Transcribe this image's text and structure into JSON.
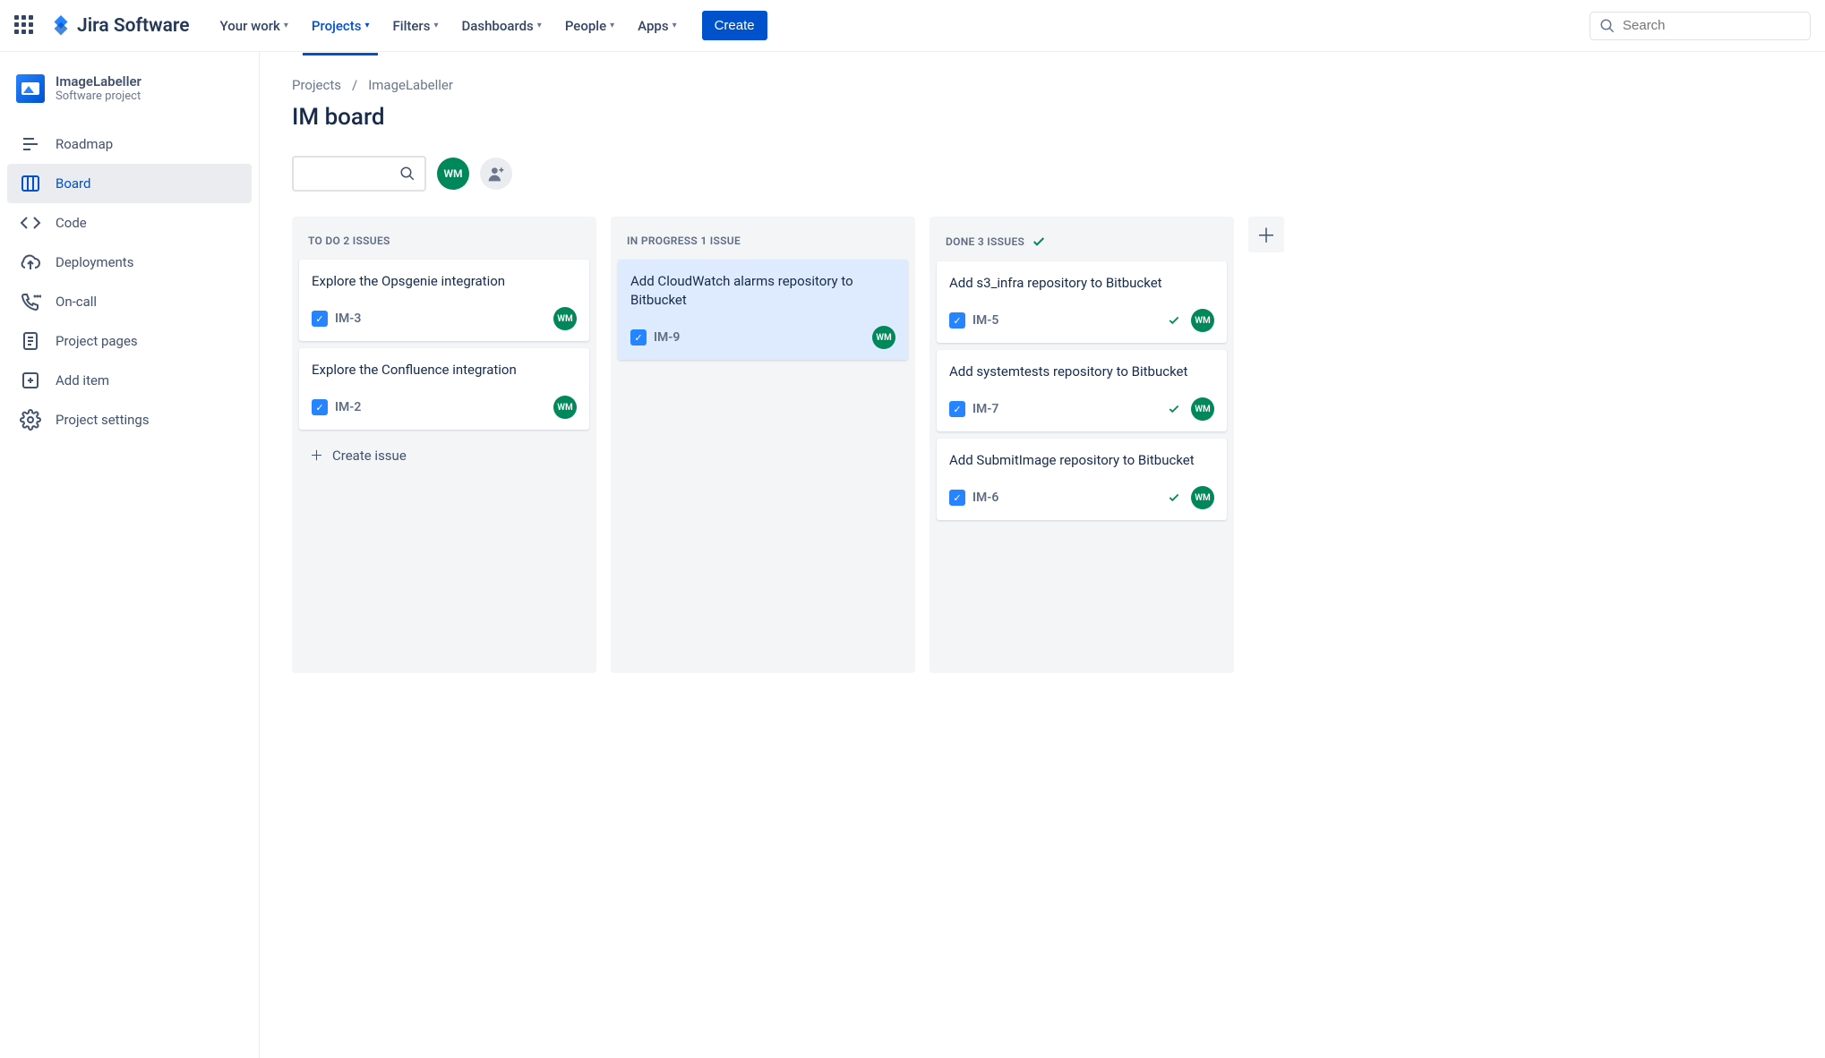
{
  "topnav": {
    "logo_text": "Jira Software",
    "items": [
      {
        "label": "Your work"
      },
      {
        "label": "Projects"
      },
      {
        "label": "Filters"
      },
      {
        "label": "Dashboards"
      },
      {
        "label": "People"
      },
      {
        "label": "Apps"
      }
    ],
    "create_label": "Create",
    "search_placeholder": "Search"
  },
  "sidebar": {
    "project_name": "ImageLabeller",
    "project_type": "Software project",
    "items": [
      {
        "label": "Roadmap"
      },
      {
        "label": "Board"
      },
      {
        "label": "Code"
      },
      {
        "label": "Deployments"
      },
      {
        "label": "On-call"
      },
      {
        "label": "Project pages"
      },
      {
        "label": "Add item"
      },
      {
        "label": "Project settings"
      }
    ]
  },
  "breadcrumb": {
    "root": "Projects",
    "current": "ImageLabeller"
  },
  "page_title": "IM board",
  "avatar_initials": "WM",
  "columns": [
    {
      "title": "TO DO 2 ISSUES",
      "done": false,
      "cards": [
        {
          "title": "Explore the Opsgenie integration",
          "key": "IM-3",
          "assignee": "WM",
          "done": false
        },
        {
          "title": "Explore the Confluence integration",
          "key": "IM-2",
          "assignee": "WM",
          "done": false
        }
      ],
      "create_issue_label": "Create issue"
    },
    {
      "title": "IN PROGRESS 1 ISSUE",
      "done": false,
      "cards": [
        {
          "title": "Add CloudWatch alarms repository to Bitbucket",
          "key": "IM-9",
          "assignee": "WM",
          "done": false,
          "highlight": true
        }
      ]
    },
    {
      "title": "DONE 3 ISSUES",
      "done": true,
      "cards": [
        {
          "title": "Add s3_infra repository to Bitbucket",
          "key": "IM-5",
          "assignee": "WM",
          "done": true
        },
        {
          "title": "Add systemtests repository to Bitbucket",
          "key": "IM-7",
          "assignee": "WM",
          "done": true
        },
        {
          "title": "Add SubmitImage repository to Bitbucket",
          "key": "IM-6",
          "assignee": "WM",
          "done": true
        }
      ]
    }
  ]
}
